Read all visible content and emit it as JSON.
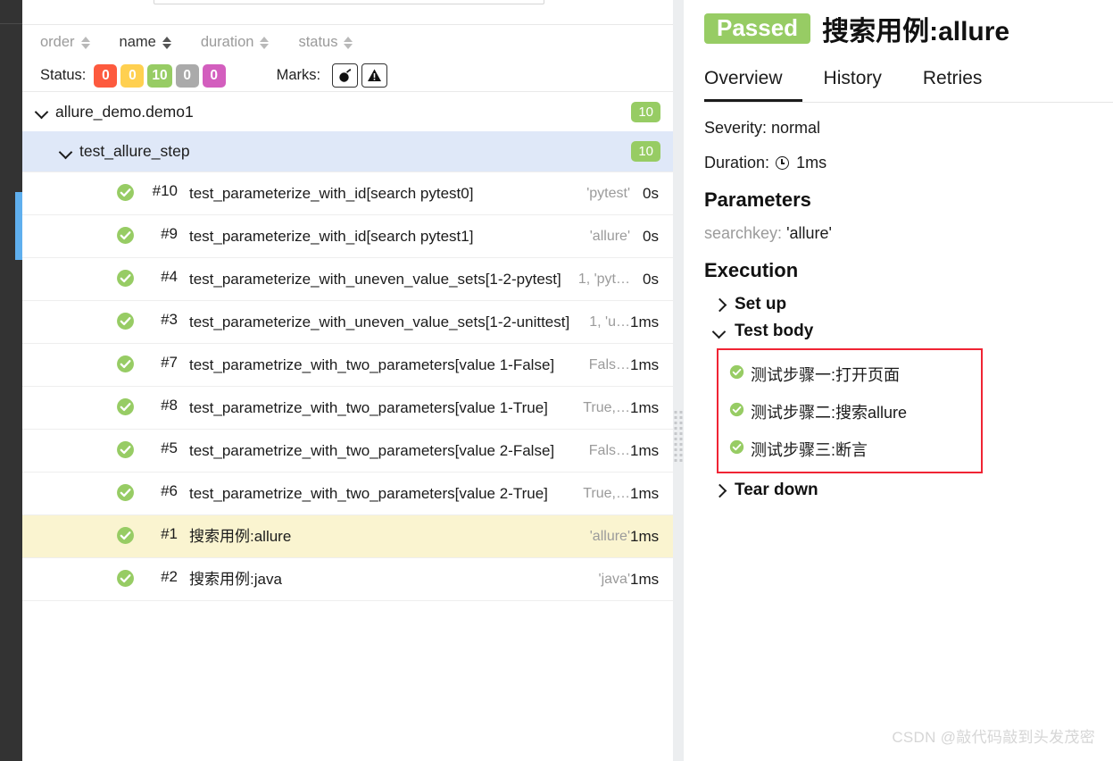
{
  "rail": {
    "active_item": "suites-rail-indicator"
  },
  "search": {
    "value": "",
    "placeholder": ""
  },
  "sort_header": {
    "columns": [
      {
        "label": "order",
        "active": false
      },
      {
        "label": "name",
        "active": true
      },
      {
        "label": "duration",
        "active": false
      },
      {
        "label": "status",
        "active": false
      }
    ]
  },
  "filters": {
    "status_label": "Status:",
    "status_chips": [
      {
        "value": "0",
        "color": "#fd5a3e",
        "name": "failed"
      },
      {
        "value": "0",
        "color": "#ffd050",
        "name": "broken"
      },
      {
        "value": "10",
        "color": "#97cc64",
        "name": "passed"
      },
      {
        "value": "0",
        "color": "#aaaaaa",
        "name": "skipped"
      },
      {
        "value": "0",
        "color": "#d35ebe",
        "name": "unknown"
      }
    ],
    "marks_label": "Marks:",
    "marks": [
      {
        "icon": "bomb-icon",
        "glyph": "💣"
      },
      {
        "icon": "warning-triangle-icon",
        "glyph": "⚠"
      }
    ]
  },
  "tree": {
    "root": {
      "label": "allure_demo.demo1",
      "count": "10",
      "expanded": true
    },
    "child": {
      "label": "test_allure_step",
      "count": "10",
      "expanded": true,
      "selected": false
    }
  },
  "tests": [
    {
      "order": "#10",
      "name": "test_parameterize_with_id[search pytest0]",
      "params": "'pytest'",
      "duration": "0s",
      "status": "passed",
      "selected": false
    },
    {
      "order": "#9",
      "name": "test_parameterize_with_id[search pytest1]",
      "params": "'allure'",
      "duration": "0s",
      "status": "passed",
      "selected": false
    },
    {
      "order": "#4",
      "name": "test_parameterize_with_uneven_value_sets[1-2-pytest]",
      "params": "1, 'pyt…",
      "duration": "0s",
      "status": "passed",
      "selected": false
    },
    {
      "order": "#3",
      "name": "test_parameterize_with_uneven_value_sets[1-2-unittest]",
      "params": "1, 'u…",
      "duration": "1ms",
      "status": "passed",
      "selected": false
    },
    {
      "order": "#7",
      "name": "test_parametrize_with_two_parameters[value 1-False]",
      "params": "Fals…",
      "duration": "1ms",
      "status": "passed",
      "selected": false
    },
    {
      "order": "#8",
      "name": "test_parametrize_with_two_parameters[value 1-True]",
      "params": "True,…",
      "duration": "1ms",
      "status": "passed",
      "selected": false
    },
    {
      "order": "#5",
      "name": "test_parametrize_with_two_parameters[value 2-False]",
      "params": "Fals…",
      "duration": "1ms",
      "status": "passed",
      "selected": false
    },
    {
      "order": "#6",
      "name": "test_parametrize_with_two_parameters[value 2-True]",
      "params": "True,…",
      "duration": "1ms",
      "status": "passed",
      "selected": false
    },
    {
      "order": "#1",
      "name": "搜索用例:allure",
      "params": "'allure'",
      "duration": "1ms",
      "status": "passed",
      "selected": true
    },
    {
      "order": "#2",
      "name": "搜索用例:java",
      "params": "'java'",
      "duration": "1ms",
      "status": "passed",
      "selected": false
    }
  ],
  "detail": {
    "status_label": "Passed",
    "status_color": "#97cc64",
    "title": "搜索用例:allure",
    "tabs": [
      {
        "label": "Overview",
        "active": true
      },
      {
        "label": "History",
        "active": false
      },
      {
        "label": "Retries",
        "active": false
      }
    ],
    "severity": "Severity: normal",
    "duration_label": "Duration:",
    "duration_value": "1ms",
    "parameters_heading": "Parameters",
    "parameters": [
      {
        "key": "searchkey",
        "value": "'allure'"
      }
    ],
    "execution_heading": "Execution",
    "execution": [
      {
        "label": "Set up",
        "expanded": false
      },
      {
        "label": "Test body",
        "expanded": true
      },
      {
        "label": "Tear down",
        "expanded": false
      }
    ],
    "steps": [
      {
        "label": "测试步骤一:打开页面",
        "status": "passed"
      },
      {
        "label": "测试步骤二:搜索allure",
        "status": "passed"
      },
      {
        "label": "测试步骤三:断言",
        "status": "passed"
      }
    ],
    "highlight_color": "#f02434"
  },
  "watermark": "CSDN @敲代码敲到头发茂密"
}
